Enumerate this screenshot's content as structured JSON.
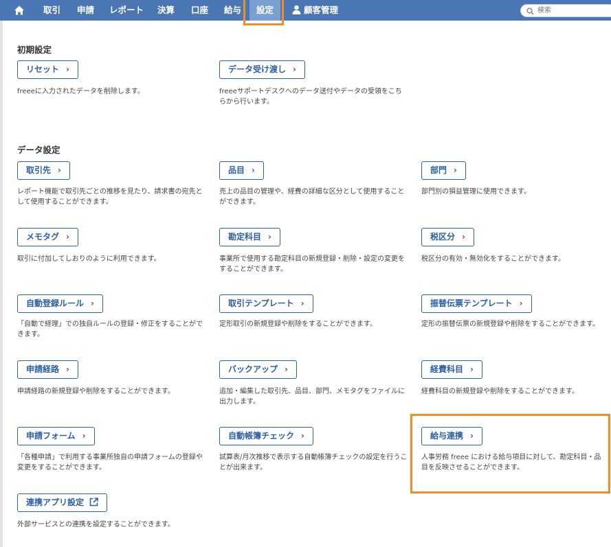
{
  "nav": {
    "items": [
      "取引",
      "申請",
      "レポート",
      "決算",
      "口座",
      "給与",
      "設定"
    ],
    "customer": "顧客管理",
    "search_placeholder": "検索"
  },
  "sections": {
    "initial": {
      "title": "初期設定",
      "cards": [
        {
          "label": "リセット",
          "desc": "freeeに入力されたデータを削除します。"
        },
        {
          "label": "データ受け渡し",
          "desc": "freeeサポートデスクへのデータ送付やデータの受領をこちらから行います。"
        }
      ]
    },
    "data": {
      "title": "データ設定",
      "cards": [
        {
          "label": "取引先",
          "desc": "レポート機能で取引先ごとの推移を見たり、請求書の宛先として使用することができます。"
        },
        {
          "label": "品目",
          "desc": "売上の品目の管理や、経費の詳細な区分として使用することができます。"
        },
        {
          "label": "部門",
          "desc": "部門別の損益管理に使用できます。"
        },
        {
          "label": "メモタグ",
          "desc": "取引に付加してしおりのように利用できます。"
        },
        {
          "label": "勘定科目",
          "desc": "事業所で使用する勘定科目の新規登録・削除・設定の変更をすることができます。"
        },
        {
          "label": "税区分",
          "desc": "税区分の有効・無効化をすることができます。"
        },
        {
          "label": "自動登録ルール",
          "desc": "「自動で経理」での独自ルールの登録・修正をすることができます。"
        },
        {
          "label": "取引テンプレート",
          "desc": "定形取引の新規登録や削除をすることができます。"
        },
        {
          "label": "振替伝票テンプレート",
          "desc": "定形の振替伝票の新規登録や削除をすることができます。"
        },
        {
          "label": "申請経路",
          "desc": "申請経路の新規登録や削除をすることができます。"
        },
        {
          "label": "バックアップ",
          "desc": "追加・編集した取引先、品目、部門、メモタグをファイルに出力します。"
        },
        {
          "label": "経費科目",
          "desc": "経費科目の新規登録や削除をすることができます。"
        },
        {
          "label": "申請フォーム",
          "desc": "「各種申請」で利用する事業所独自の申請フォームの登録や変更をすることができます。"
        },
        {
          "label": "自動帳簿チェック",
          "desc": "試算表/月次推移で表示する自動帳簿チェックの設定を行うことが出来ます。"
        },
        {
          "label": "給与連携",
          "desc": "人事労務 freee における給与項目に対して、勘定科目・品目を反映させることができます。"
        },
        {
          "label": "連携アプリ設定",
          "desc": "外部サービスとの連携を設定することができます。"
        }
      ]
    }
  },
  "colors": {
    "nav_bg": "#4a76b4",
    "accent": "#2c5fa3",
    "highlight": "#f28c28"
  },
  "icons": {
    "home": "home-icon",
    "user": "user-icon",
    "search": "search-icon",
    "chevron": "chevron-right-icon",
    "external": "external-link-icon"
  }
}
